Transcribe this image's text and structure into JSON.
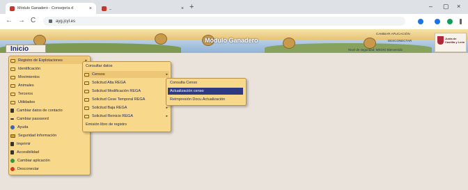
{
  "browser": {
    "tabs": [
      {
        "title": "Módulo Ganadero - Consejería d",
        "close": "×"
      },
      {
        "title": "_",
        "close": "×"
      }
    ],
    "new_tab": "+",
    "window_controls": [
      "–",
      "▢",
      "×"
    ],
    "nav": {
      "back": "←",
      "forward": "→",
      "reload": "C"
    },
    "url": "ayg.jcyl.es",
    "extension_colors": [
      "#1a73e8",
      "#0f9d58",
      "#5f6368"
    ]
  },
  "header": {
    "title": "Módulo Ganadero",
    "inicio": "Inicio",
    "right_top_1": "CAMBIAR APLICACIÓN",
    "right_top_2": "DESCONECTAR",
    "right_small": "Nivel de seguridad: MEDIO   Bienvenido",
    "logo_text": "Junta de Castilla y León",
    "logo_color": "#b0263b"
  },
  "menus": {
    "main": [
      {
        "label": "Registro de Explotaciones",
        "icon": "folder-icon",
        "highlight": true,
        "arrow": "▸"
      },
      {
        "label": "Identificación",
        "icon": "folder-icon"
      },
      {
        "label": "Movimientos",
        "icon": "folder-icon"
      },
      {
        "label": "Animales",
        "icon": "folder-icon"
      },
      {
        "label": "Terceros",
        "icon": "folder-icon"
      },
      {
        "label": "Utilidades",
        "icon": "folder-icon"
      },
      {
        "label": "Cambiar datos de contacto",
        "icon": "person-icon"
      },
      {
        "label": "Cambiar password",
        "icon": "arrow-icon"
      },
      {
        "label": "Ayuda",
        "icon": "help-icon"
      },
      {
        "label": "Seguridad Información",
        "icon": "lock-icon"
      },
      {
        "label": "Imprimir",
        "icon": "print-icon"
      },
      {
        "label": "Accesibilidad",
        "icon": "accessibility-icon"
      },
      {
        "label": "Cambiar aplicación",
        "icon": "switch-app-icon"
      },
      {
        "label": "Desconectar",
        "icon": "power-icon"
      }
    ],
    "registro": [
      {
        "label": "Consultar datos",
        "icon": ""
      },
      {
        "label": "Censos",
        "icon": "folder-icon",
        "highlight": true,
        "arrow": "▸"
      },
      {
        "label": "Solicitud Alta REGA",
        "icon": "folder-icon"
      },
      {
        "label": "Solicitud Modificación REGA",
        "icon": "folder-icon"
      },
      {
        "label": "Solicitud Cese Temporal REGA",
        "icon": "folder-icon"
      },
      {
        "label": "Solicitud Baja REGA",
        "icon": "folder-icon",
        "arrow": "▸"
      },
      {
        "label": "Solicitud Reinicio REGA",
        "icon": "folder-icon",
        "arrow": "▸"
      },
      {
        "label": "Emisión libro de registro",
        "icon": ""
      }
    ],
    "censos": [
      {
        "label": "Consulta Censo"
      },
      {
        "label": "Actualización censo",
        "selected": true
      },
      {
        "label": "Reimpresión Docu.Actualización"
      }
    ]
  }
}
